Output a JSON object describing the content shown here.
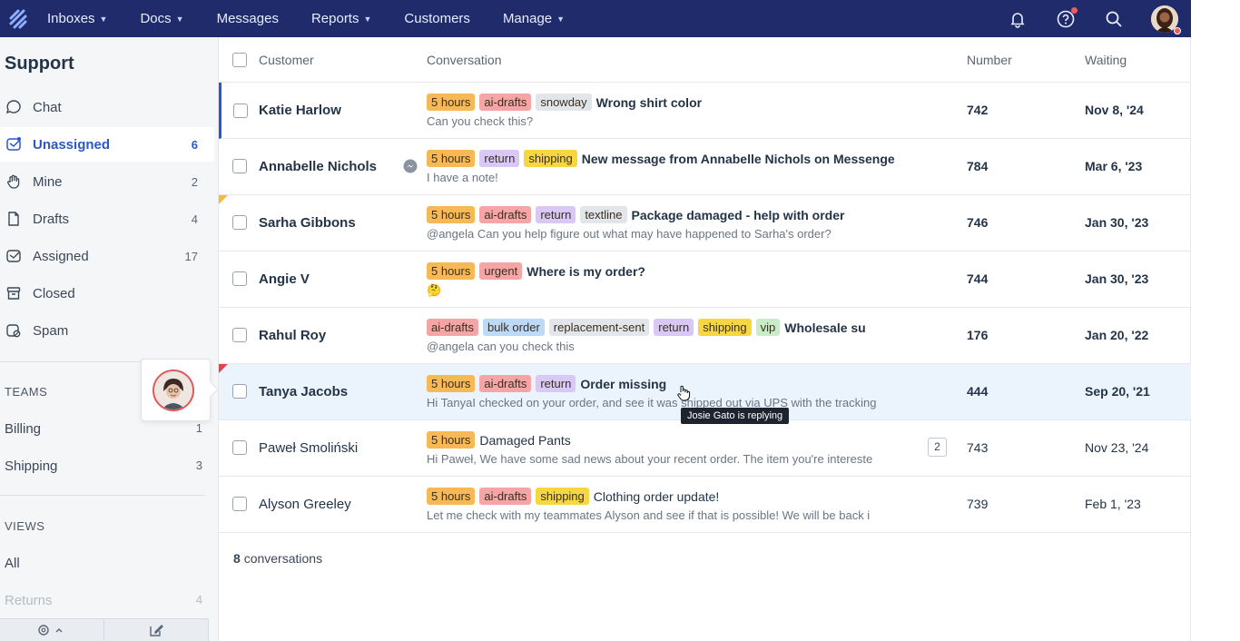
{
  "nav": {
    "items": [
      {
        "label": "Inboxes",
        "dropdown": true
      },
      {
        "label": "Docs",
        "dropdown": true
      },
      {
        "label": "Messages",
        "dropdown": false
      },
      {
        "label": "Reports",
        "dropdown": true
      },
      {
        "label": "Customers",
        "dropdown": false
      },
      {
        "label": "Manage",
        "dropdown": true
      }
    ],
    "icons": [
      "notifications-bell-icon",
      "help-icon",
      "search-icon",
      "user-avatar"
    ]
  },
  "sidebar": {
    "title": "Support",
    "items": [
      {
        "label": "Chat",
        "count": "",
        "icon": "chat-icon",
        "active": false
      },
      {
        "label": "Unassigned",
        "count": "6",
        "icon": "unassigned-icon",
        "active": true
      },
      {
        "label": "Mine",
        "count": "2",
        "icon": "hand-icon",
        "active": false
      },
      {
        "label": "Drafts",
        "count": "4",
        "icon": "draft-icon",
        "active": false
      },
      {
        "label": "Assigned",
        "count": "17",
        "icon": "assigned-icon",
        "active": false
      },
      {
        "label": "Closed",
        "count": "",
        "icon": "archive-icon",
        "active": false
      },
      {
        "label": "Spam",
        "count": "",
        "icon": "spam-icon",
        "active": false
      }
    ],
    "teams_header": "TEAMS",
    "teams": [
      {
        "label": "Billing",
        "count": "1"
      },
      {
        "label": "Shipping",
        "count": "3"
      }
    ],
    "views_header": "VIEWS",
    "views": [
      {
        "label": "All",
        "count": ""
      },
      {
        "label": "Returns",
        "count": "4"
      }
    ]
  },
  "table": {
    "headers": {
      "customer": "Customer",
      "conversation": "Conversation",
      "number": "Number",
      "waiting": "Waiting"
    },
    "rows": [
      {
        "customer": "Katie Harlow",
        "tags": [
          "5 hours",
          "ai-drafts",
          "snowday"
        ],
        "subject": "Wrong shirt color",
        "preview": "Can you check this?",
        "number": "742",
        "waiting": "Nov 8, '24"
      },
      {
        "customer": "Annabelle Nichols",
        "tags": [
          "5 hours",
          "return",
          "shipping"
        ],
        "subject": "New message from Annabelle Nichols on Messenger",
        "preview": "I have a note!",
        "number": "784",
        "waiting": "Mar 6, '23"
      },
      {
        "customer": "Sarha Gibbons",
        "tags": [
          "5 hours",
          "ai-drafts",
          "return",
          "textline"
        ],
        "subject": "Package damaged - help with order",
        "preview": "@angela Can you help figure out what may have happened to Sarha's order?",
        "number": "746",
        "waiting": "Jan 30, '23"
      },
      {
        "customer": "Angie V",
        "tags": [
          "5 hours",
          "urgent"
        ],
        "subject": "Where is my order?",
        "preview": "🤔",
        "number": "744",
        "waiting": "Jan 30, '23"
      },
      {
        "customer": "Rahul Roy",
        "tags": [
          "ai-drafts",
          "bulk order",
          "replacement-sent",
          "return",
          "shipping",
          "vip"
        ],
        "subject": "Wholesale su",
        "preview": "@angela can you check this",
        "number": "176",
        "waiting": "Jan 20, '22"
      },
      {
        "customer": "Tanya Jacobs",
        "tags": [
          "5 hours",
          "ai-drafts",
          "return"
        ],
        "subject": "Order missing",
        "preview": "Hi TanyaI checked on your order, and see it was shipped out via UPS with the tracking",
        "number": "444",
        "waiting": "Sep 20, '21"
      },
      {
        "customer": "Paweł Smoliński",
        "tags": [
          "5 hours"
        ],
        "subject": "Damaged Pants",
        "preview": "Hi Paweł, We have some sad news about your recent order. The item you're intereste",
        "number": "743",
        "waiting": "Nov 23, '24",
        "badge": "2"
      },
      {
        "customer": "Alyson Greeley",
        "tags": [
          "5 hours",
          "ai-drafts",
          "shipping"
        ],
        "subject": "Clothing order update!",
        "preview": "Let me check with my teammates Alyson and see if that is possible! We will be back i",
        "number": "739",
        "waiting": "Feb 1, '23"
      }
    ]
  },
  "tooltip": "Josie Gato is replying",
  "footer": {
    "count": "8",
    "label": "conversations"
  },
  "colors": {
    "nav_bg": "#1f2b6b",
    "accent": "#2b57c7",
    "tag_5hours": "#f7b955",
    "tag_aidrafts": "#f5a5a5",
    "tag_return": "#d9c8f5",
    "tag_shipping": "#f7d740",
    "tag_grey": "#e2e5e9",
    "tag_bulk": "#bcd9f7",
    "tag_vip": "#c8ecc8"
  }
}
